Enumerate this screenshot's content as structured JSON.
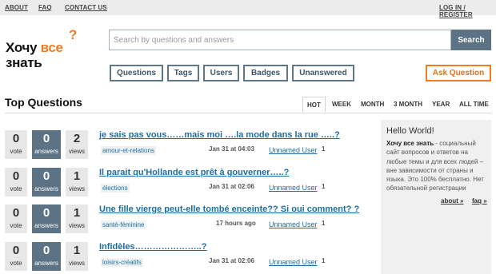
{
  "topbar": {
    "about": "ABOUT",
    "faq": "FAQ",
    "contact": "CONTACT US",
    "login": "LOG IN / REGISTER"
  },
  "logo": {
    "line1_part1": "Хочу ",
    "line1_part2": "все",
    "line2": "знать",
    "question_mark": "?"
  },
  "search": {
    "placeholder": "Search by questions and answers",
    "button": "Search"
  },
  "nav": [
    "Questions",
    "Tags",
    "Users",
    "Badges",
    "Unanswered"
  ],
  "ask_button": "Ask Question",
  "section_title": "Top Questions",
  "sort_tabs": [
    "HOT",
    "WEEK",
    "MONTH",
    "3 MONTH",
    "YEAR",
    "ALL TIME"
  ],
  "questions": [
    {
      "votes": "0",
      "votes_label": "vote",
      "answers": "0",
      "answers_label": "answers",
      "views": "2",
      "views_label": "views",
      "title": "je sais pas vous……mais moi ….la mode dans la rue …..?",
      "tag": "amour-et-relations",
      "time": "Jan 31 at 04:03",
      "user": "Unnamed User",
      "rep": "1"
    },
    {
      "votes": "0",
      "votes_label": "vote",
      "answers": "0",
      "answers_label": "answers",
      "views": "1",
      "views_label": "views",
      "title": "Il parait qu'Hollande est prêt à gouverner…..?",
      "tag": "élections",
      "time": "Jan 31 at 02:06",
      "user": "Unnamed User",
      "rep": "1"
    },
    {
      "votes": "0",
      "votes_label": "vote",
      "answers": "0",
      "answers_label": "answers",
      "views": "1",
      "views_label": "views",
      "title": "Une fille vierge peut-elle tombé enceinte?? Si oui comment? ?",
      "tag": "santé-féminine",
      "time": "17 hours ago",
      "user": "Unnamed User",
      "rep": "1"
    },
    {
      "votes": "0",
      "votes_label": "vote",
      "answers": "0",
      "answers_label": "answers",
      "views": "1",
      "views_label": "views",
      "title": "Infidèles…………………..?",
      "tag": "loisirs-créatifs",
      "time": "Jan 31 at 02:06",
      "user": "Unnamed User",
      "rep": "1"
    }
  ],
  "sidebar": {
    "title": "Hello World!",
    "brand": "Хочу все знать",
    "text": " - социальный сайт вопросов и ответов на любые темы и для всех людей – вне зависимости от страны и языка. Это 100% бесплатно. Нет обязательной регистрации",
    "about_link": "about »",
    "faq_link": "faq »"
  }
}
